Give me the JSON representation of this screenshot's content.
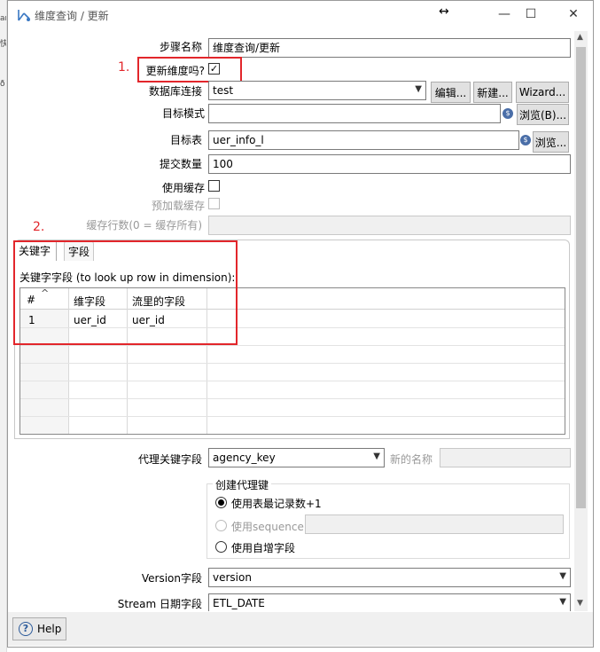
{
  "window": {
    "title": "维度查询 / 更新",
    "move_glyph": "↔",
    "minimize_glyph": "—",
    "maximize_glyph": "☐",
    "close_glyph": "✕"
  },
  "background_app": {
    "fragments": [
      "ar",
      "快",
      "ð"
    ]
  },
  "annotations": {
    "marker1": "1.",
    "marker2": "2.",
    "color": "#e2262b"
  },
  "form": {
    "step_name_label": "步骤名称",
    "step_name_value": "维度查询/更新",
    "update_dim_label": "更新维度吗?",
    "update_dim_checked": "✓",
    "db_conn_label": "数据库连接",
    "db_conn_value": "test",
    "edit_button": "编辑...",
    "new_button": "新建...",
    "wizard_button": "Wizard...",
    "target_schema_label": "目标模式",
    "target_schema_value": "",
    "browse_b_button": "浏览(B)...",
    "target_table_label": "目标表",
    "target_table_value": "uer_info_l",
    "browse_button": "浏览...",
    "commit_label": "提交数量",
    "commit_value": "100",
    "use_cache_label": "使用缓存",
    "preload_cache_label": "预加载缓存",
    "cache_rows_label": "缓存行数(0 = 缓存所有)",
    "cache_rows_value": "",
    "var_icon": "$"
  },
  "tabs": {
    "items": [
      "关键字",
      "字段"
    ],
    "active": "关键字",
    "panel_caption": "关键字字段 (to look up row in dimension):"
  },
  "key_table": {
    "headers": [
      "#",
      "维字段",
      "流里的字段"
    ],
    "sort_glyph": "^",
    "rows": [
      [
        "1",
        "uer_id",
        "uer_id"
      ]
    ]
  },
  "surrogate": {
    "label": "代理关键字段",
    "value": "agency_key",
    "new_name_label": "新的名称",
    "new_name_value": "",
    "group_title": "创建代理键",
    "opt_table_max": "使用表最记录数+1",
    "opt_sequence": "使用sequence",
    "sequence_value": "",
    "opt_autoinc": "使用自增字段"
  },
  "version": {
    "label": "Version字段",
    "value": "version"
  },
  "stream_date": {
    "label": "Stream 日期字段",
    "value": "ETL_DATE"
  },
  "help": {
    "label": "Help",
    "icon": "?"
  }
}
